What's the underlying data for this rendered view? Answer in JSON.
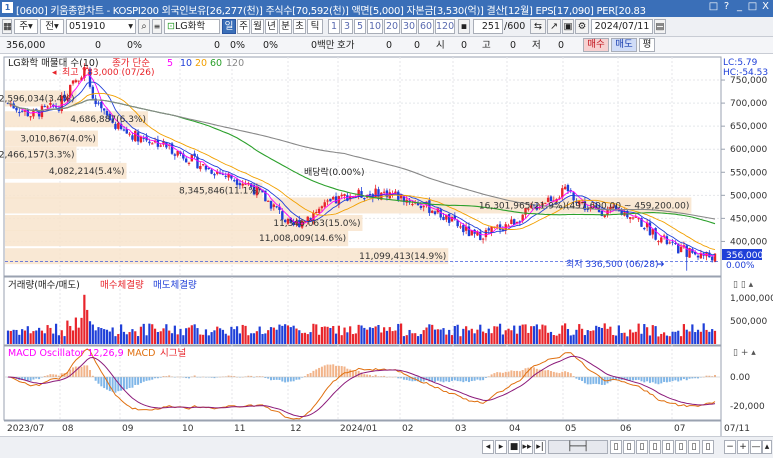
{
  "titlebar": {
    "text": "[0600] 키움종합차트 - KOSPI200 외국인보유[26,277(천)] 주식수[70,592(천)] 액면[5,000] 자본금[3,530(억)] 결산[12월] EPS[17,090] PER[20.83",
    "window_buttons": [
      "□",
      "?",
      "_",
      "□",
      "X"
    ]
  },
  "toolbar": {
    "period_label": "주",
    "prev_label": "전",
    "stock_code": "051910",
    "stock_name": "LG화학",
    "interval_buttons": [
      "일",
      "주",
      "월",
      "년",
      "분",
      "초",
      "틱"
    ],
    "minute_buttons": [
      "1",
      "3",
      "5",
      "10",
      "20",
      "30",
      "60",
      "120"
    ],
    "count": "251",
    "total": "/600",
    "date": "2024/07/11"
  },
  "pricebar": {
    "price": "356,000",
    "change": "0",
    "pct1": "0%",
    "v1": "0",
    "pct2": "0%",
    "pct3": "0%",
    "unit_label": "0백만",
    "quote_label": "호가",
    "v2": "0",
    "v3": "0",
    "si_label": "시",
    "v4": "0",
    "go_label": "고",
    "v5": "0",
    "jeo_label": "저",
    "v6": "0",
    "buy_button": "매수",
    "sell_button": "매도",
    "avg_button": "평"
  },
  "price_panel": {
    "legend_stock": "LG화학 매물대 수(10)",
    "legend_ma": "종가 단순",
    "ma_periods": [
      "5",
      "10",
      "20",
      "60",
      "120"
    ],
    "lc_label": "LC:5.79",
    "hc_label": "HC:-54.53",
    "y_labels": [
      "750,000",
      "700,000",
      "650,000",
      "600,000",
      "550,000",
      "500,000",
      "450,000",
      "400,000"
    ],
    "current_price": "356,000",
    "current_pct": "0.00%",
    "high_label": "최고 783,000 (07/26)",
    "low_label": "최저 336,500 (06/28)",
    "dividend_label": "배당락(0.00%)",
    "volume_profile": [
      {
        "text": "2,596,034(3.4%)",
        "price": 710000,
        "len": 0.1
      },
      {
        "text": "4,686,887(6.3%)",
        "price": 665000,
        "len": 0.2
      },
      {
        "text": "3,010,867(4.0%)",
        "price": 623000,
        "len": 0.13
      },
      {
        "text": "2,466,157(3.3%)",
        "price": 588000,
        "len": 0.1
      },
      {
        "text": "4,082,214(5.4%)",
        "price": 553000,
        "len": 0.17
      },
      {
        "text": "8,345,846(11.1%)",
        "price": 510000,
        "len": 0.36
      },
      {
        "text": "16,301,965(21.9%)(497,600.00 ~ 459,200.00)",
        "price": 478000,
        "len": 0.96
      },
      {
        "text": "11,346,063(15.0%)",
        "price": 440000,
        "len": 0.5
      },
      {
        "text": "11,008,009(14.6%)",
        "price": 407000,
        "len": 0.48
      },
      {
        "text": "11,099,413(14.9%)",
        "price": 368000,
        "len": 0.62
      }
    ]
  },
  "volume_panel": {
    "legend_title": "거래량(매수/매도)",
    "legend_buy": "매수체결량",
    "legend_sell": "매도체결량",
    "y_labels": [
      "1,000,000",
      "500,000"
    ]
  },
  "macd_panel": {
    "legend_osc": "MACD Oscillator 12,26,9",
    "legend_macd": "MACD",
    "legend_signal": "시그널",
    "y_labels": [
      "0.00",
      "-20,000"
    ]
  },
  "time_axis": {
    "labels": [
      "2023/07",
      "08",
      "09",
      "10",
      "11",
      "12",
      "2024/01",
      "02",
      "03",
      "04",
      "05",
      "06",
      "07",
      "07/11"
    ]
  },
  "colors": {
    "up": "#e8242b",
    "down": "#1f3fd8",
    "ma5": "#ff00ff",
    "ma10": "#1f3fd8",
    "ma20": "#f2a000",
    "ma60": "#2ca02c",
    "ma120": "#888888",
    "profile": "#f8e4cc"
  }
}
